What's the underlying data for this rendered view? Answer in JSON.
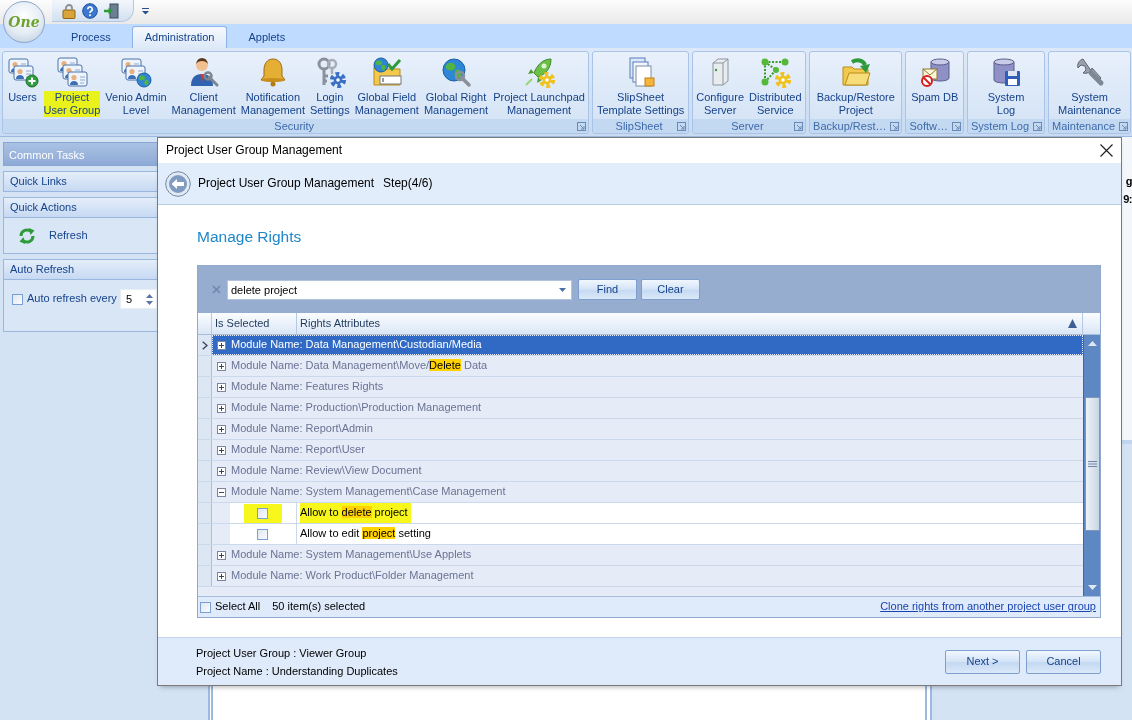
{
  "app": {
    "logo_text": "One"
  },
  "ribbon": {
    "tabs": [
      {
        "label": "Process",
        "selected": false
      },
      {
        "label": "Administration",
        "selected": true
      },
      {
        "label": "Applets",
        "selected": false
      }
    ],
    "groups": [
      {
        "label": "Security",
        "buttons": [
          {
            "lines": [
              "Users"
            ],
            "highlighted": false
          },
          {
            "lines": [
              "Project",
              "User Group"
            ],
            "highlighted": true
          },
          {
            "lines": [
              "Venio Admin",
              "Level"
            ],
            "highlighted": false
          },
          {
            "lines": [
              "Client",
              "Management"
            ],
            "highlighted": false
          },
          {
            "lines": [
              "Notification",
              "Management"
            ],
            "highlighted": false
          },
          {
            "lines": [
              "Login",
              "Settings"
            ],
            "highlighted": false
          },
          {
            "lines": [
              "Global Field",
              "Management"
            ],
            "highlighted": false
          },
          {
            "lines": [
              "Global Right",
              "Management"
            ],
            "highlighted": false
          },
          {
            "lines": [
              "Project Launchpad",
              "Management"
            ],
            "highlighted": false
          }
        ]
      },
      {
        "label": "SlipSheet",
        "buttons": [
          {
            "lines": [
              "SlipSheet",
              "Template Settings"
            ],
            "highlighted": false
          }
        ]
      },
      {
        "label": "Server",
        "buttons": [
          {
            "lines": [
              "Configure",
              "Server"
            ],
            "highlighted": false
          },
          {
            "lines": [
              "Distributed",
              "Service"
            ],
            "highlighted": false
          }
        ]
      },
      {
        "label": "Backup/Rest…",
        "buttons": [
          {
            "lines": [
              "Backup/Restore",
              "Project"
            ],
            "highlighted": false
          }
        ]
      },
      {
        "label": "Softw…",
        "buttons": [
          {
            "lines": [
              "Spam DB"
            ],
            "highlighted": false
          }
        ]
      },
      {
        "label": "System Log",
        "buttons": [
          {
            "lines": [
              "System",
              "Log"
            ],
            "highlighted": false
          }
        ]
      },
      {
        "label": "Maintenance",
        "buttons": [
          {
            "lines": [
              "System",
              "Maintenance"
            ],
            "highlighted": false
          }
        ]
      }
    ]
  },
  "task_pane": {
    "title": "Common Tasks",
    "sections": [
      {
        "kind": "header",
        "title": "Quick Links"
      },
      {
        "kind": "actions",
        "title": "Quick Actions",
        "items": [
          {
            "label": "Refresh"
          }
        ]
      },
      {
        "kind": "auto_refresh",
        "title": "Auto Refresh",
        "checkbox": {
          "label": "Auto refresh every",
          "checked": false
        },
        "interval": "5"
      }
    ]
  },
  "background_window": {
    "fragments": [
      "g",
      "9:"
    ]
  },
  "dialog": {
    "title": "Project User Group Management",
    "wizard": {
      "title": "Project User Group Management",
      "step": "Step(4/6)"
    },
    "heading": "Manage Rights",
    "search": {
      "value": "delete project",
      "buttons": [
        "Find",
        "Clear"
      ]
    },
    "grid": {
      "columns": [
        {
          "label": "Is Selected",
          "sorted": false
        },
        {
          "label": "Rights Attributes",
          "sorted": true
        }
      ],
      "rows": [
        {
          "parts": [
            {
              "text": "Module Name: Data Management\\Custodian/Media",
              "match": false
            }
          ],
          "expanded": false,
          "selected": true
        },
        {
          "parts": [
            {
              "text": "Module Name: Data Management\\Move/",
              "match": false
            },
            {
              "text": "Delete",
              "match": true
            },
            {
              "text": " Data",
              "match": false
            }
          ],
          "expanded": false,
          "selected": false
        },
        {
          "parts": [
            {
              "text": "Module Name: Features Rights",
              "match": false
            }
          ],
          "expanded": false,
          "selected": false
        },
        {
          "parts": [
            {
              "text": "Module Name: Production\\Production Management",
              "match": false
            }
          ],
          "expanded": false,
          "selected": false
        },
        {
          "parts": [
            {
              "text": "Module Name: Report\\Admin",
              "match": false
            }
          ],
          "expanded": false,
          "selected": false
        },
        {
          "parts": [
            {
              "text": "Module Name: Report\\User",
              "match": false
            }
          ],
          "expanded": false,
          "selected": false
        },
        {
          "parts": [
            {
              "text": "Module Name: Review\\View Document",
              "match": false
            }
          ],
          "expanded": false,
          "selected": false
        },
        {
          "parts": [
            {
              "text": "Module Name: System Management\\Case Management",
              "match": false
            }
          ],
          "expanded": true,
          "selected": false,
          "children": [
            {
              "parts": [
                {
                  "text": "Allow to ",
                  "match": false
                },
                {
                  "text": "delete",
                  "match": true
                },
                {
                  "text": " project",
                  "match": false
                }
              ],
              "checked": false,
              "highlighted": true,
              "selected": false
            },
            {
              "parts": [
                {
                  "text": "Allow to edit ",
                  "match": false
                },
                {
                  "text": "project",
                  "match": true
                },
                {
                  "text": " setting",
                  "match": false
                }
              ],
              "checked": false,
              "highlighted": false,
              "selected": false
            }
          ]
        },
        {
          "parts": [
            {
              "text": "Module Name: System Management\\Use Applets",
              "match": false
            }
          ],
          "expanded": false,
          "selected": false
        },
        {
          "parts": [
            {
              "text": "Module Name: Work Product\\Folder Management",
              "match": false
            }
          ],
          "expanded": false,
          "selected": false
        }
      ]
    },
    "footer": {
      "select_all": {
        "label": "Select All",
        "checked": false
      },
      "count": "50 item(s) selected",
      "link": "Clone rights from another project user group"
    },
    "info": [
      "Project User Group : Viewer Group",
      "Project Name : Understanding Duplicates"
    ],
    "buttons": [
      "Next >",
      "Cancel"
    ]
  }
}
